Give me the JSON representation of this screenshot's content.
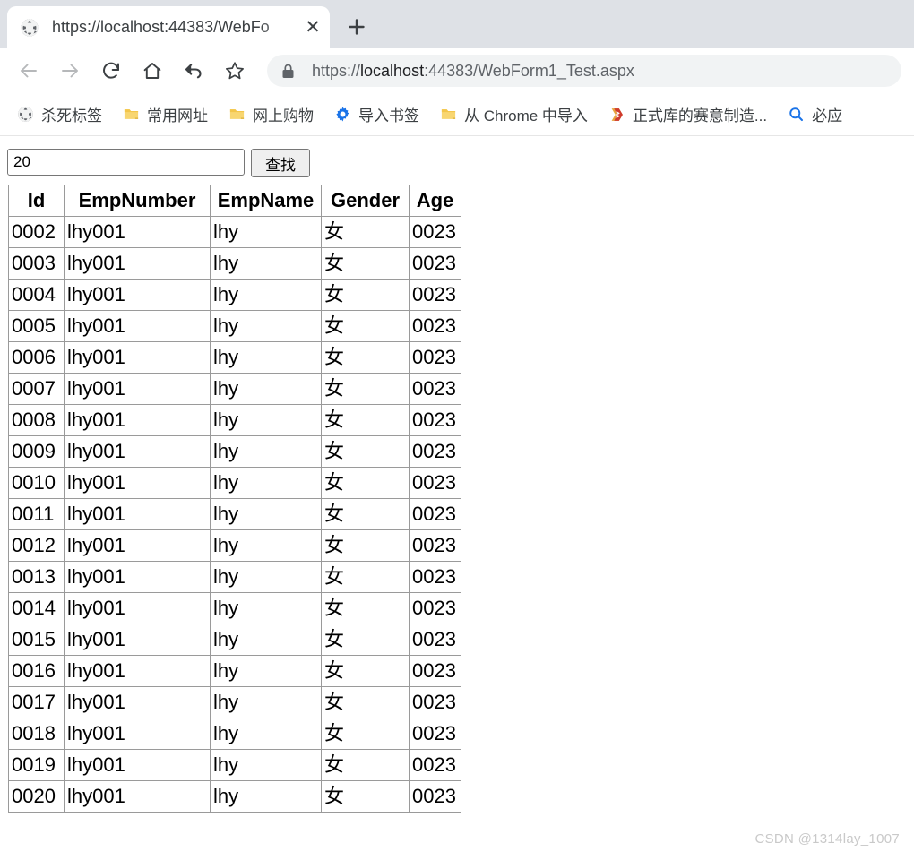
{
  "browser": {
    "tab": {
      "favicon": "globe-icon",
      "title": "https://localhost:44383/WebFo",
      "close_label": "✕"
    },
    "new_tab_label": "+",
    "toolbar": {
      "buttons": [
        {
          "name": "back-button",
          "icon": "arrow-left-icon",
          "enabled": false
        },
        {
          "name": "forward-button",
          "icon": "arrow-right-icon",
          "enabled": false
        },
        {
          "name": "reload-button",
          "icon": "reload-icon",
          "enabled": true
        },
        {
          "name": "home-button",
          "icon": "home-icon",
          "enabled": true
        },
        {
          "name": "undo-button",
          "icon": "undo-arrow-icon",
          "enabled": true
        },
        {
          "name": "bookmark-star-button",
          "icon": "star-icon",
          "enabled": true
        }
      ],
      "omnibox": {
        "security_icon": "lock-icon",
        "scheme": "https://",
        "host": "localhost",
        "rest": ":44383/WebForm1_Test.aspx",
        "full_url": "https://localhost:44383/WebForm1_Test.aspx"
      }
    },
    "bookmarks": [
      {
        "label": "杀死标签",
        "icon": "globe-icon"
      },
      {
        "label": "常用网址",
        "icon": "folder-icon"
      },
      {
        "label": "网上购物",
        "icon": "folder-icon"
      },
      {
        "label": "导入书签",
        "icon": "gear-icon"
      },
      {
        "label": "从 Chrome 中导入",
        "icon": "folder-icon"
      },
      {
        "label": "正式库的赛意制造...",
        "icon": "ssms-icon"
      },
      {
        "label": "必应",
        "icon": "search-icon"
      }
    ]
  },
  "page": {
    "search": {
      "input_value": "20",
      "input_placeholder": "",
      "button_label": "查找"
    },
    "table": {
      "columns": [
        "Id",
        "EmpNumber",
        "EmpName",
        "Gender",
        "Age"
      ],
      "rows": [
        [
          "0002",
          "lhy001",
          "lhy",
          "女",
          "0023"
        ],
        [
          "0003",
          "lhy001",
          "lhy",
          "女",
          "0023"
        ],
        [
          "0004",
          "lhy001",
          "lhy",
          "女",
          "0023"
        ],
        [
          "0005",
          "lhy001",
          "lhy",
          "女",
          "0023"
        ],
        [
          "0006",
          "lhy001",
          "lhy",
          "女",
          "0023"
        ],
        [
          "0007",
          "lhy001",
          "lhy",
          "女",
          "0023"
        ],
        [
          "0008",
          "lhy001",
          "lhy",
          "女",
          "0023"
        ],
        [
          "0009",
          "lhy001",
          "lhy",
          "女",
          "0023"
        ],
        [
          "0010",
          "lhy001",
          "lhy",
          "女",
          "0023"
        ],
        [
          "0011",
          "lhy001",
          "lhy",
          "女",
          "0023"
        ],
        [
          "0012",
          "lhy001",
          "lhy",
          "女",
          "0023"
        ],
        [
          "0013",
          "lhy001",
          "lhy",
          "女",
          "0023"
        ],
        [
          "0014",
          "lhy001",
          "lhy",
          "女",
          "0023"
        ],
        [
          "0015",
          "lhy001",
          "lhy",
          "女",
          "0023"
        ],
        [
          "0016",
          "lhy001",
          "lhy",
          "女",
          "0023"
        ],
        [
          "0017",
          "lhy001",
          "lhy",
          "女",
          "0023"
        ],
        [
          "0018",
          "lhy001",
          "lhy",
          "女",
          "0023"
        ],
        [
          "0019",
          "lhy001",
          "lhy",
          "女",
          "0023"
        ],
        [
          "0020",
          "lhy001",
          "lhy",
          "女",
          "0023"
        ]
      ]
    },
    "watermark": "CSDN @1314lay_1007"
  },
  "colors": {
    "tab_strip": "#dee1e6",
    "omnibox_bg": "#f1f3f4",
    "text": "#3c4043",
    "folder_yellow": "#f6c445",
    "accent_blue": "#1a73e8",
    "table_border": "#9a9a9a",
    "watermark": "#c9c9c9"
  }
}
